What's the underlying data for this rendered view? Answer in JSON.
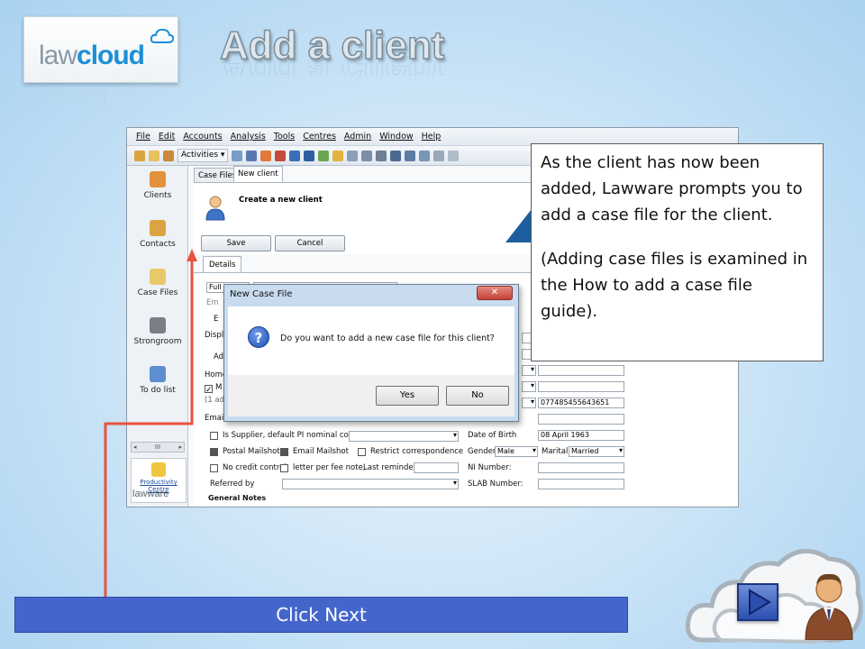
{
  "logo": {
    "law": "law",
    "cloud": "cloud"
  },
  "title": "Add a client",
  "app": {
    "menu": [
      "File",
      "Edit",
      "Accounts",
      "Analysis",
      "Tools",
      "Centres",
      "Admin",
      "Window",
      "Help"
    ],
    "activities_label": "Activities",
    "sidebar": [
      {
        "label": "Clients",
        "icon": "clients-icon"
      },
      {
        "label": "Contacts",
        "icon": "contacts-icon"
      },
      {
        "label": "Case Files",
        "icon": "case-files-icon"
      },
      {
        "label": "Strongroom",
        "icon": "strongroom-icon"
      },
      {
        "label": "To do list",
        "icon": "todo-icon"
      }
    ],
    "sidebar_scroll": "III",
    "productivity": {
      "line1": "Productivity",
      "line2": "Centre"
    },
    "lawware": "lawware",
    "tabs": [
      "Case Files",
      "New client"
    ],
    "header_label": "Create a new client",
    "save_label": "Save",
    "cancel_label": "Cancel",
    "details_tab": "Details",
    "form": {
      "full_label": "Full",
      "em_label": "Em",
      "e_label": "E",
      "disp_label": "Displ",
      "ad_label": "Ad",
      "home_label": "Home",
      "m_label": "M",
      "one_add": "(1 ad",
      "email_label": "Email",
      "phone_value": "077485455643651",
      "is_supplier": "Is Supplier, default PI nominal code:",
      "postal_mailshot": "Postal Mailshot",
      "email_mailshot": "Email Mailshot",
      "restrict_corr": "Restrict correspondence",
      "no_credit": "No credit control",
      "letter_fee": "letter per fee note,",
      "last_reminder": "Last reminder",
      "referred_by": "Referred by",
      "general_notes": "General Notes",
      "dob_label": "Date of Birth",
      "dob_value": "08 April 1963",
      "gender_label": "Gender",
      "gender_value": "Male",
      "marital_label": "Marital",
      "marital_value": "Married",
      "ni_label": "NI Number:",
      "slab_label": "SLAB Number:"
    }
  },
  "dialog": {
    "title": "New Case File",
    "message": "Do you want to add a new case file for this client?",
    "yes": "Yes",
    "no": "No",
    "close": "✕"
  },
  "callout": {
    "p1": "As the client has now been added, Lawware prompts you to add a case file for the client.",
    "p2": "(Adding case files is examined in the How to add a case file guide)."
  },
  "next_bar": "Click Next",
  "colors": {
    "accent_blue": "#4466cc",
    "arrow_red": "#e8533f",
    "cloud_blue": "#1e8fd6"
  }
}
